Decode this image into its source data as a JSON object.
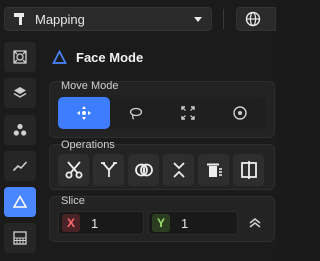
{
  "topbar": {
    "mode": "Mapping"
  },
  "tools": [
    "transform-tool",
    "layers-tool",
    "cluster-tool",
    "graph-tool",
    "face-mode-tool",
    "texture-tool"
  ],
  "panel": {
    "title": "Face Mode",
    "move_mode": {
      "label": "Move Mode",
      "options": [
        "move",
        "lasso",
        "expand",
        "point"
      ],
      "selected": "move"
    },
    "operations": {
      "label": "Operations",
      "items": [
        "cut",
        "merge",
        "intersect",
        "collapse",
        "delete",
        "split"
      ]
    },
    "slice": {
      "label": "Slice",
      "x_axis": "X",
      "x_value": "1",
      "y_axis": "Y",
      "y_value": "1"
    }
  },
  "colors": {
    "accent": "#4a86ff",
    "axis_x": "#ff6a6a",
    "axis_y": "#9be36a"
  }
}
